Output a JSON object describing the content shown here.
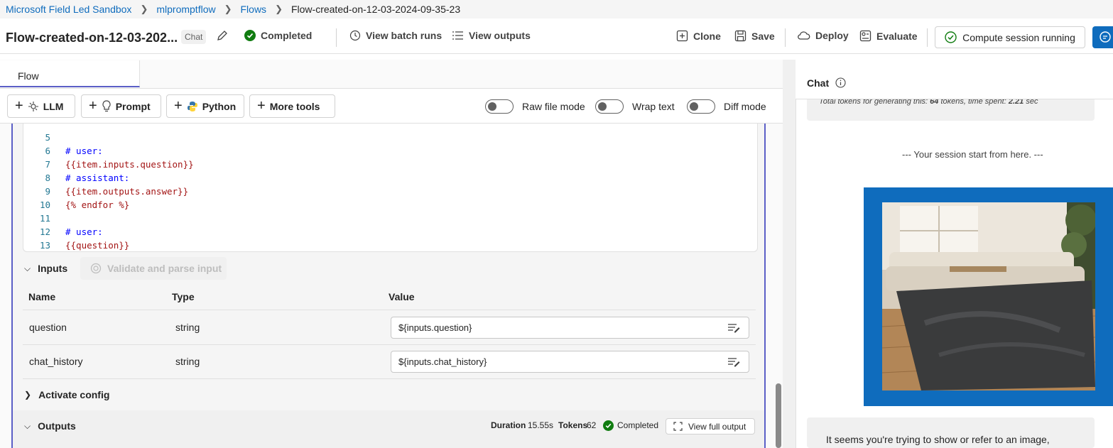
{
  "breadcrumb": [
    "Microsoft Field Led Sandbox",
    "mlpromptflow",
    "Flows",
    "Flow-created-on-12-03-2024-09-35-23"
  ],
  "header": {
    "title": "Flow-created-on-12-03-202...",
    "chip": "Chat",
    "status": "Completed",
    "view_batch_runs": "View batch runs",
    "view_outputs": "View outputs",
    "clone": "Clone",
    "save": "Save",
    "deploy": "Deploy",
    "evaluate": "Evaluate",
    "compute": "Compute session running"
  },
  "tabs": {
    "flow": "Flow"
  },
  "toolbar": {
    "llm": "LLM",
    "prompt": "Prompt",
    "python": "Python",
    "more_tools": "More tools",
    "raw_file_mode": "Raw file mode",
    "wrap_text": "Wrap text",
    "diff_mode": "Diff mode"
  },
  "code": [
    {
      "n": "6",
      "t": "{{item.inputs.question}}"
    },
    {
      "n": "7",
      "t": "# assistant:"
    },
    {
      "n": "8",
      "t": "{{item.outputs.answer}}"
    },
    {
      "n": "9",
      "t": "{% endfor %}"
    },
    {
      "n": "10",
      "t": ""
    },
    {
      "n": "11",
      "t": "# user:"
    },
    {
      "n": "12",
      "t": "{{question}}"
    },
    {
      "n": "13",
      "t": ""
    }
  ],
  "code_partial": {
    "n": "5",
    "t": "# user:"
  },
  "inputs": {
    "section": "Inputs",
    "validate": "Validate and parse input",
    "headers": {
      "name": "Name",
      "type": "Type",
      "value": "Value"
    },
    "rows": [
      {
        "name": "question",
        "type": "string",
        "value": "${inputs.question}"
      },
      {
        "name": "chat_history",
        "type": "string",
        "value": "${inputs.chat_history}"
      }
    ]
  },
  "activate_config": "Activate config",
  "outputs": {
    "section": "Outputs",
    "duration_label": "Duration",
    "duration": "15.55s",
    "tokens_label": "Tokens",
    "tokens": "62",
    "status": "Completed",
    "view_full": "View full output"
  },
  "chat": {
    "title": "Chat",
    "tokens_prefix": "Total tokens for generating this:",
    "tokens_count": "64",
    "tokens_mid": "tokens, time spent:",
    "tokens_time": "2.21",
    "tokens_unit": "sec",
    "session_start": "--- Your session start from here. ---",
    "reply": "It seems you're trying to show or refer to an image,"
  },
  "colors": {
    "accent": "#0f6cbd",
    "success": "#107c10",
    "node_border": "#5b5fc7"
  }
}
